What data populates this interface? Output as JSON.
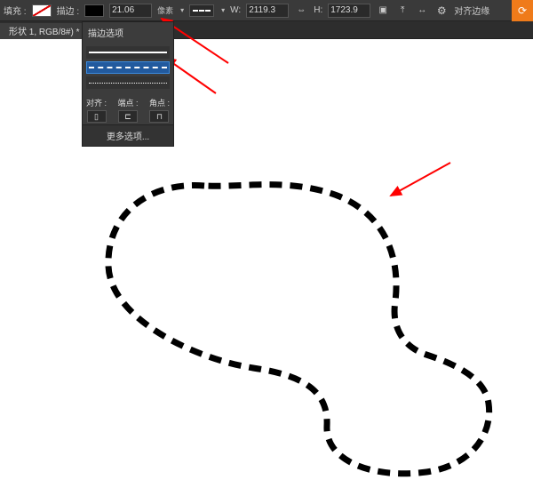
{
  "toolbar": {
    "fill_label": "填充 :",
    "stroke_label": "描边 :",
    "stroke_width": "21.06",
    "stroke_unit": "像素",
    "w_label": "W:",
    "w_value": "2119.3",
    "link_label": "⇔",
    "h_label": "H:",
    "h_value": "1723.9",
    "align_label": "对齐边缘"
  },
  "tab": {
    "name": "形状 1, RGB/8#) *",
    "close": "×"
  },
  "stroke_panel": {
    "title": "描边选项",
    "align_label": "对齐 :",
    "caps_label": "端点 :",
    "corners_label": "角点 :",
    "more": "更多选项..."
  },
  "icons": {
    "gear": "⚙",
    "align1": "⤒",
    "align2": "↔",
    "bool": "▣",
    "orange": "⟳"
  }
}
